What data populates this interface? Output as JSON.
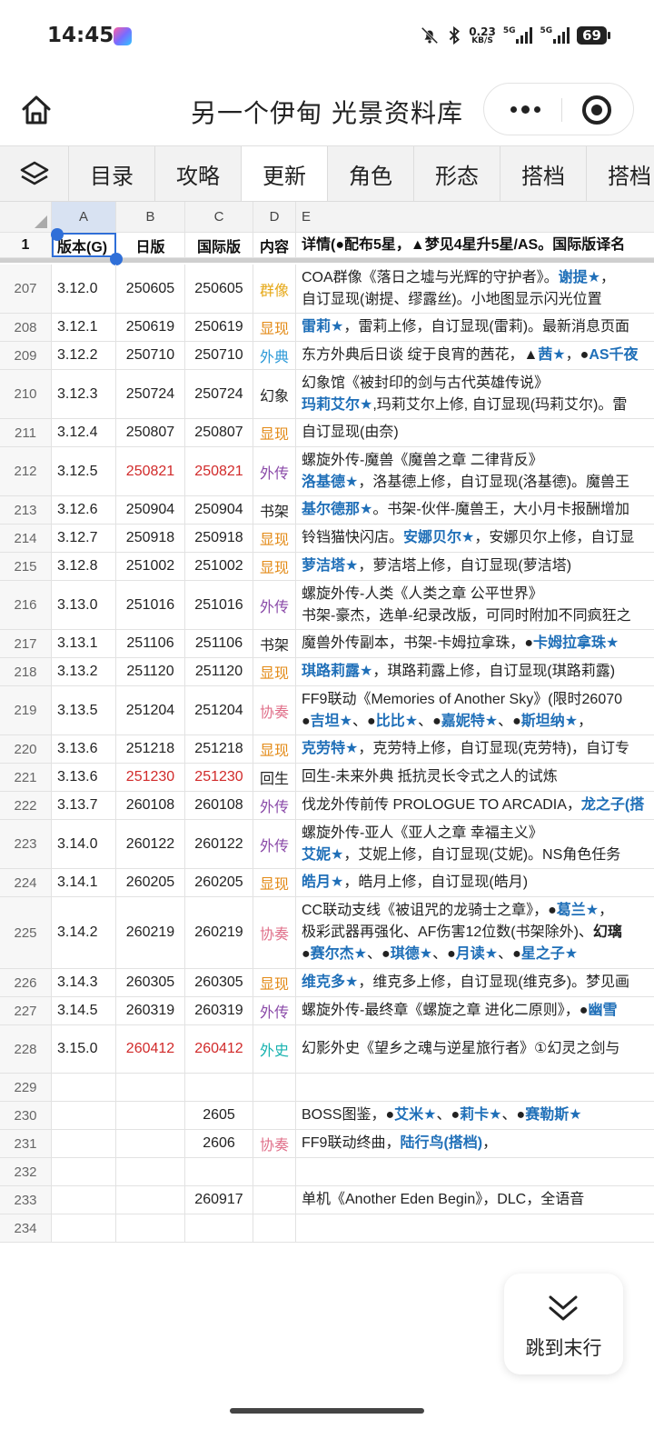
{
  "status": {
    "time": "14:45",
    "speed_value": "0.23",
    "speed_unit": "KB/S",
    "net1": "5G",
    "net2": "5G",
    "battery": "69"
  },
  "app": {
    "title": "另一个伊甸 光景资料库"
  },
  "tabs": [
    "目录",
    "攻略",
    "更新",
    "角色",
    "形态",
    "搭档",
    "搭档"
  ],
  "active_tab": 2,
  "columns": [
    "A",
    "B",
    "C",
    "D",
    "E"
  ],
  "header_row": {
    "num": "1",
    "a": "版本(G)",
    "b": "日版",
    "c": "国际版",
    "d": "内容",
    "e": "详情(●配布5星，▲梦见4星升5星/AS。国际版译名"
  },
  "rows": [
    {
      "num": "207",
      "a": "3.12.0",
      "b": "250605",
      "c": "250605",
      "d": "群像",
      "dcolor": "yellow",
      "lines": [
        [
          [
            "COA群像《落日之墟与光辉的守护者》。",
            ""
          ],
          [
            "谢提★",
            "blue"
          ],
          [
            "，",
            ""
          ]
        ],
        [
          [
            "自订显现(谢提、缪露丝)。小地图显示闪光位置",
            ""
          ]
        ]
      ]
    },
    {
      "num": "208",
      "a": "3.12.1",
      "b": "250619",
      "c": "250619",
      "d": "显现",
      "dcolor": "orange",
      "lines": [
        [
          [
            "雷莉★",
            "blue"
          ],
          [
            "，雷莉上修，自订显现(雷莉)。最新消息页面",
            ""
          ]
        ]
      ]
    },
    {
      "num": "209",
      "a": "3.12.2",
      "b": "250710",
      "c": "250710",
      "d": "外典",
      "dcolor": "sky",
      "lines": [
        [
          [
            "东方外典后日谈 绽于良宵的茜花，▲",
            ""
          ],
          [
            "茜★",
            "blue"
          ],
          [
            "，●",
            ""
          ],
          [
            "AS千夜",
            "blue"
          ]
        ]
      ]
    },
    {
      "num": "210",
      "a": "3.12.3",
      "b": "250724",
      "c": "250724",
      "d": "幻象",
      "dcolor": "",
      "lines": [
        [
          [
            "幻象馆《被封印的剑与古代英雄传说》",
            ""
          ]
        ],
        [
          [
            "玛莉艾尔★",
            "blue"
          ],
          [
            ",玛莉艾尔上修, 自订显现(玛莉艾尔)。雷",
            ""
          ]
        ]
      ]
    },
    {
      "num": "211",
      "a": "3.12.4",
      "b": "250807",
      "c": "250807",
      "d": "显现",
      "dcolor": "orange",
      "lines": [
        [
          [
            "自订显现(由奈)",
            ""
          ]
        ]
      ]
    },
    {
      "num": "212",
      "a": "3.12.5",
      "b": "250821",
      "c": "250821",
      "bred": true,
      "d": "外传",
      "dcolor": "purple",
      "lines": [
        [
          [
            "螺旋外传-魔兽《魔兽之章 二律背反》",
            ""
          ]
        ],
        [
          [
            "洛基德★",
            "blue"
          ],
          [
            "，洛基德上修，自订显现(洛基德)。魔兽王",
            ""
          ]
        ]
      ]
    },
    {
      "num": "213",
      "a": "3.12.6",
      "b": "250904",
      "c": "250904",
      "d": "书架",
      "dcolor": "",
      "lines": [
        [
          [
            "基尔德那★",
            "blue"
          ],
          [
            "。书架-伙伴-魔兽王，大小月卡报酬增加",
            ""
          ]
        ]
      ]
    },
    {
      "num": "214",
      "a": "3.12.7",
      "b": "250918",
      "c": "250918",
      "d": "显现",
      "dcolor": "orange",
      "lines": [
        [
          [
            "铃铛猫快闪店。",
            ""
          ],
          [
            "安娜贝尔★",
            "blue"
          ],
          [
            "，安娜贝尔上修，自订显",
            ""
          ]
        ]
      ]
    },
    {
      "num": "215",
      "a": "3.12.8",
      "b": "251002",
      "c": "251002",
      "d": "显现",
      "dcolor": "orange",
      "lines": [
        [
          [
            "萝洁塔★",
            "blue"
          ],
          [
            "，萝洁塔上修，自订显现(萝洁塔)",
            ""
          ]
        ]
      ]
    },
    {
      "num": "216",
      "a": "3.13.0",
      "b": "251016",
      "c": "251016",
      "d": "外传",
      "dcolor": "purple",
      "lines": [
        [
          [
            "螺旋外传-人类《人类之章 公平世界》",
            ""
          ]
        ],
        [
          [
            "书架-豪杰，选单-纪录改版，可同时附加不同疯狂之",
            ""
          ]
        ]
      ]
    },
    {
      "num": "217",
      "a": "3.13.1",
      "b": "251106",
      "c": "251106",
      "d": "书架",
      "dcolor": "",
      "lines": [
        [
          [
            "魔兽外传副本，书架-卡姆拉拿珠，●",
            ""
          ],
          [
            "卡姆拉拿珠★",
            "blue"
          ]
        ]
      ]
    },
    {
      "num": "218",
      "a": "3.13.2",
      "b": "251120",
      "c": "251120",
      "d": "显现",
      "dcolor": "orange",
      "lines": [
        [
          [
            "琪路莉露★",
            "blue"
          ],
          [
            "，琪路莉露上修，自订显现(琪路莉露)",
            ""
          ]
        ]
      ]
    },
    {
      "num": "219",
      "a": "3.13.5",
      "b": "251204",
      "c": "251204",
      "d": "协奏",
      "dcolor": "pink",
      "lines": [
        [
          [
            "FF9联动《Memories of Another Sky》(限时26070",
            ""
          ]
        ],
        [
          [
            "●",
            ""
          ],
          [
            "吉坦★",
            "blue"
          ],
          [
            "、●",
            ""
          ],
          [
            "比比★",
            "blue"
          ],
          [
            "、●",
            ""
          ],
          [
            "嘉妮特★",
            "blue"
          ],
          [
            "、●",
            ""
          ],
          [
            "斯坦纳★",
            "blue"
          ],
          [
            "，",
            ""
          ]
        ]
      ]
    },
    {
      "num": "220",
      "a": "3.13.6",
      "b": "251218",
      "c": "251218",
      "d": "显现",
      "dcolor": "orange",
      "lines": [
        [
          [
            "克劳特★",
            "blue"
          ],
          [
            "，克劳特上修，自订显现(克劳特)，自订专",
            ""
          ]
        ]
      ]
    },
    {
      "num": "221",
      "a": "3.13.6",
      "b": "251230",
      "c": "251230",
      "bred": true,
      "d": "回生",
      "dcolor": "",
      "lines": [
        [
          [
            "回生-未来外典 抵抗灵长令式之人的试炼",
            ""
          ]
        ]
      ]
    },
    {
      "num": "222",
      "a": "3.13.7",
      "b": "260108",
      "c": "260108",
      "d": "外传",
      "dcolor": "purple",
      "lines": [
        [
          [
            "伐龙外传前传 PROLOGUE TO ARCADIA，",
            ""
          ],
          [
            "龙之子(搭",
            "blue"
          ]
        ]
      ]
    },
    {
      "num": "223",
      "a": "3.14.0",
      "b": "260122",
      "c": "260122",
      "d": "外传",
      "dcolor": "purple",
      "lines": [
        [
          [
            "螺旋外传-亚人《亚人之章 幸福主义》",
            ""
          ]
        ],
        [
          [
            "艾妮★",
            "blue"
          ],
          [
            "，艾妮上修，自订显现(艾妮)。NS角色任务",
            ""
          ]
        ]
      ]
    },
    {
      "num": "224",
      "a": "3.14.1",
      "b": "260205",
      "c": "260205",
      "d": "显现",
      "dcolor": "orange",
      "lines": [
        [
          [
            "皓月★",
            "blue"
          ],
          [
            "，皓月上修，自订显现(皓月)",
            ""
          ]
        ]
      ]
    },
    {
      "num": "225",
      "a": "3.14.2",
      "b": "260219",
      "c": "260219",
      "d": "协奏",
      "dcolor": "pink",
      "lines": [
        [
          [
            "CC联动支线《被诅咒的龙骑士之章》，●",
            ""
          ],
          [
            "葛兰★",
            "blue"
          ],
          [
            "，",
            ""
          ]
        ],
        [
          [
            "极彩武器再强化、AF伤害12位数(书架除外)、",
            ""
          ],
          [
            "幻璃",
            "bold"
          ]
        ],
        [
          [
            "●",
            ""
          ],
          [
            "赛尔杰★",
            "blue"
          ],
          [
            "、●",
            ""
          ],
          [
            "琪德★",
            "blue"
          ],
          [
            "、●",
            ""
          ],
          [
            "月读★",
            "blue"
          ],
          [
            "、●",
            ""
          ],
          [
            "星之子★",
            "blue"
          ]
        ]
      ]
    },
    {
      "num": "226",
      "a": "3.14.3",
      "b": "260305",
      "c": "260305",
      "d": "显现",
      "dcolor": "orange",
      "lines": [
        [
          [
            "维克多★",
            "blue"
          ],
          [
            "，维克多上修，自订显现(维克多)。梦见画",
            ""
          ]
        ]
      ]
    },
    {
      "num": "227",
      "a": "3.14.5",
      "b": "260319",
      "c": "260319",
      "d": "外传",
      "dcolor": "purple",
      "lines": [
        [
          [
            "螺旋外传-最终章《螺旋之章 进化二原则》，●",
            ""
          ],
          [
            "幽雪",
            "blue"
          ]
        ]
      ]
    },
    {
      "num": "228",
      "a": "3.15.0",
      "b": "260412",
      "c": "260412",
      "bred": true,
      "d": "外史",
      "dcolor": "teal",
      "lines": [
        [
          [
            "幻影外史《望乡之魂与逆星旅行者》①幻灵之剑与",
            ""
          ]
        ]
      ]
    },
    {
      "num": "229",
      "a": "",
      "b": "",
      "c": "",
      "d": "",
      "dcolor": "",
      "lines": []
    },
    {
      "num": "230",
      "a": "",
      "b": "",
      "c": "2605",
      "d": "",
      "dcolor": "",
      "lines": [
        [
          [
            "BOSS图鉴，●",
            ""
          ],
          [
            "艾米★",
            "blue"
          ],
          [
            "、●",
            ""
          ],
          [
            "莉卡★",
            "blue"
          ],
          [
            "、●",
            ""
          ],
          [
            "赛勒斯★",
            "blue"
          ]
        ]
      ]
    },
    {
      "num": "231",
      "a": "",
      "b": "",
      "c": "2606",
      "d": "协奏",
      "dcolor": "pink",
      "lines": [
        [
          [
            "FF9联动终曲，",
            ""
          ],
          [
            "陆行鸟(搭档)",
            "blue"
          ],
          [
            "，",
            ""
          ]
        ]
      ]
    },
    {
      "num": "232",
      "a": "",
      "b": "",
      "c": "",
      "d": "",
      "dcolor": "",
      "lines": []
    },
    {
      "num": "233",
      "a": "",
      "b": "",
      "c": "260917",
      "d": "",
      "dcolor": "",
      "lines": [
        [
          [
            "单机《Another Eden Begin》，DLC，全语音",
            ""
          ]
        ]
      ]
    },
    {
      "num": "234",
      "a": "",
      "b": "",
      "c": "",
      "d": "",
      "dcolor": "",
      "lines": []
    }
  ],
  "jump_button": {
    "label": "跳到末行"
  }
}
